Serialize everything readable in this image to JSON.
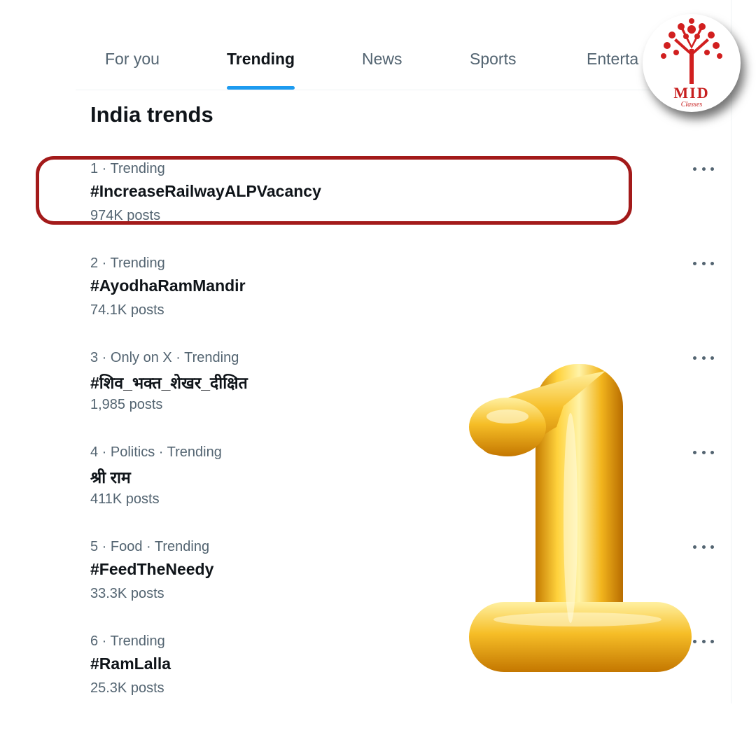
{
  "tabs": [
    {
      "label": "For you",
      "active": false
    },
    {
      "label": "Trending",
      "active": true
    },
    {
      "label": "News",
      "active": false
    },
    {
      "label": "Sports",
      "active": false
    },
    {
      "label": "Enterta",
      "active": false
    }
  ],
  "page_title": "India trends",
  "trends": [
    {
      "meta": "1 · Trending",
      "name": "#IncreaseRailwayALPVacancy",
      "posts": "974K posts"
    },
    {
      "meta": "2 · Trending",
      "name": "#AyodhaRamMandir",
      "posts": "74.1K posts"
    },
    {
      "meta": "3 · Only on X · Trending",
      "name": "#शिव_भक्त_शेखर_दीक्षित",
      "posts": "1,985 posts"
    },
    {
      "meta": "4 · Politics · Trending",
      "name": "श्री राम",
      "posts": "411K posts"
    },
    {
      "meta": "5 · Food · Trending",
      "name": "#FeedTheNeedy",
      "posts": "33.3K posts"
    },
    {
      "meta": "6 · Trending",
      "name": "#RamLalla",
      "posts": "25.3K posts"
    }
  ],
  "more_icon": "more-horizontal-icon",
  "logo": {
    "text": "MID",
    "subtext": "Classes",
    "color": "#c71f1f"
  },
  "colors": {
    "accent": "#1d9bf0",
    "highlight": "#a31a1a",
    "muted": "#536471",
    "gold": "#f2b51d"
  }
}
